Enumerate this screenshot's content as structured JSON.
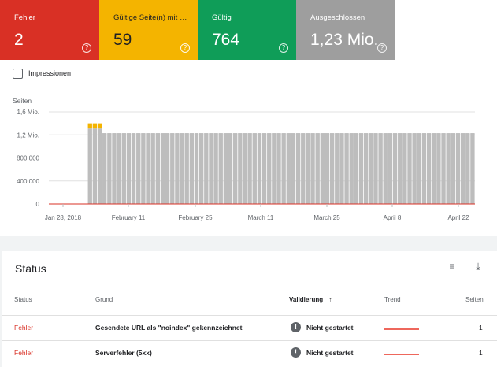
{
  "tiles": [
    {
      "label": "Fehler",
      "value": "2",
      "color": "#d93025"
    },
    {
      "label": "Gültige Seite(n) mit Warnungen",
      "value": "59",
      "color": "#f4b400"
    },
    {
      "label": "Gültig",
      "value": "764",
      "color": "#0f9d58"
    },
    {
      "label": "Ausgeschlossen",
      "value": "1,23 Mio.",
      "color": "#9e9e9e"
    }
  ],
  "help_glyph": "?",
  "impressions_label": "Impressionen",
  "chart_data": {
    "type": "bar",
    "ylabel": "Seiten",
    "yticks": [
      "1,6 Mio.",
      "1,2 Mio.",
      "800.000",
      "400.000",
      "0"
    ],
    "ylim": [
      0,
      1600000
    ],
    "xticks": [
      "Jan 28, 2018",
      "February 11",
      "February 25",
      "March 11",
      "March 25",
      "April 8",
      "April 22"
    ],
    "series": [
      {
        "name": "Ausgeschlossen",
        "color": "#bdbdbd",
        "values": [
          0,
          0,
          0,
          0,
          0,
          0,
          0,
          0,
          1310000,
          1310000,
          1310000,
          1230000,
          1230000,
          1230000,
          1230000,
          1230000,
          1230000,
          1230000,
          1230000,
          1230000,
          1230000,
          1230000,
          1230000,
          1230000,
          1230000,
          1230000,
          1230000,
          1230000,
          1230000,
          1230000,
          1230000,
          1230000,
          1230000,
          1230000,
          1230000,
          1230000,
          1230000,
          1230000,
          1230000,
          1230000,
          1230000,
          1230000,
          1230000,
          1230000,
          1230000,
          1230000,
          1230000,
          1230000,
          1230000,
          1230000,
          1230000,
          1230000,
          1230000,
          1230000,
          1230000,
          1230000,
          1230000,
          1230000,
          1230000,
          1230000,
          1230000,
          1230000,
          1230000,
          1230000,
          1230000,
          1230000,
          1230000,
          1230000,
          1230000,
          1230000,
          1230000,
          1230000,
          1230000,
          1230000,
          1230000,
          1230000,
          1230000,
          1230000,
          1230000,
          1230000,
          1230000,
          1230000,
          1230000,
          1230000,
          1230000,
          1230000,
          1230000,
          1230000
        ]
      },
      {
        "name": "Gültige Seite(n) mit Warnungen",
        "color": "#f4b400",
        "values": [
          0,
          0,
          0,
          0,
          0,
          0,
          0,
          0,
          90000,
          90000,
          90000,
          0,
          0,
          0,
          0,
          0,
          0,
          0,
          0,
          0,
          0,
          0,
          0,
          0,
          0,
          0,
          0,
          0,
          0,
          0,
          0,
          0,
          0,
          0,
          0,
          0,
          0,
          0,
          0,
          0,
          0,
          0,
          0,
          0,
          0,
          0,
          0,
          0,
          0,
          0,
          0,
          0,
          0,
          0,
          0,
          0,
          0,
          0,
          0,
          0,
          0,
          0,
          0,
          0,
          0,
          0,
          0,
          0,
          0,
          0,
          0,
          0,
          0,
          0,
          0,
          0,
          0,
          0,
          0,
          0,
          0,
          0,
          0,
          0,
          0,
          0,
          0,
          0
        ]
      }
    ]
  },
  "status": {
    "title": "Status",
    "filter_icon": "≡",
    "download_icon": "⤓",
    "headers": {
      "status": "Status",
      "grund": "Grund",
      "validierung": "Validierung",
      "sort": "↑",
      "trend": "Trend",
      "seiten": "Seiten"
    },
    "rows": [
      {
        "status": "Fehler",
        "grund": "Gesendete URL als \"noindex\" gekennzeichnet",
        "validierung": "Nicht gestartet",
        "seiten": "1"
      },
      {
        "status": "Fehler",
        "grund": "Serverfehler (5xx)",
        "validierung": "Nicht gestartet",
        "seiten": "1"
      }
    ],
    "excl_glyph": "!"
  }
}
